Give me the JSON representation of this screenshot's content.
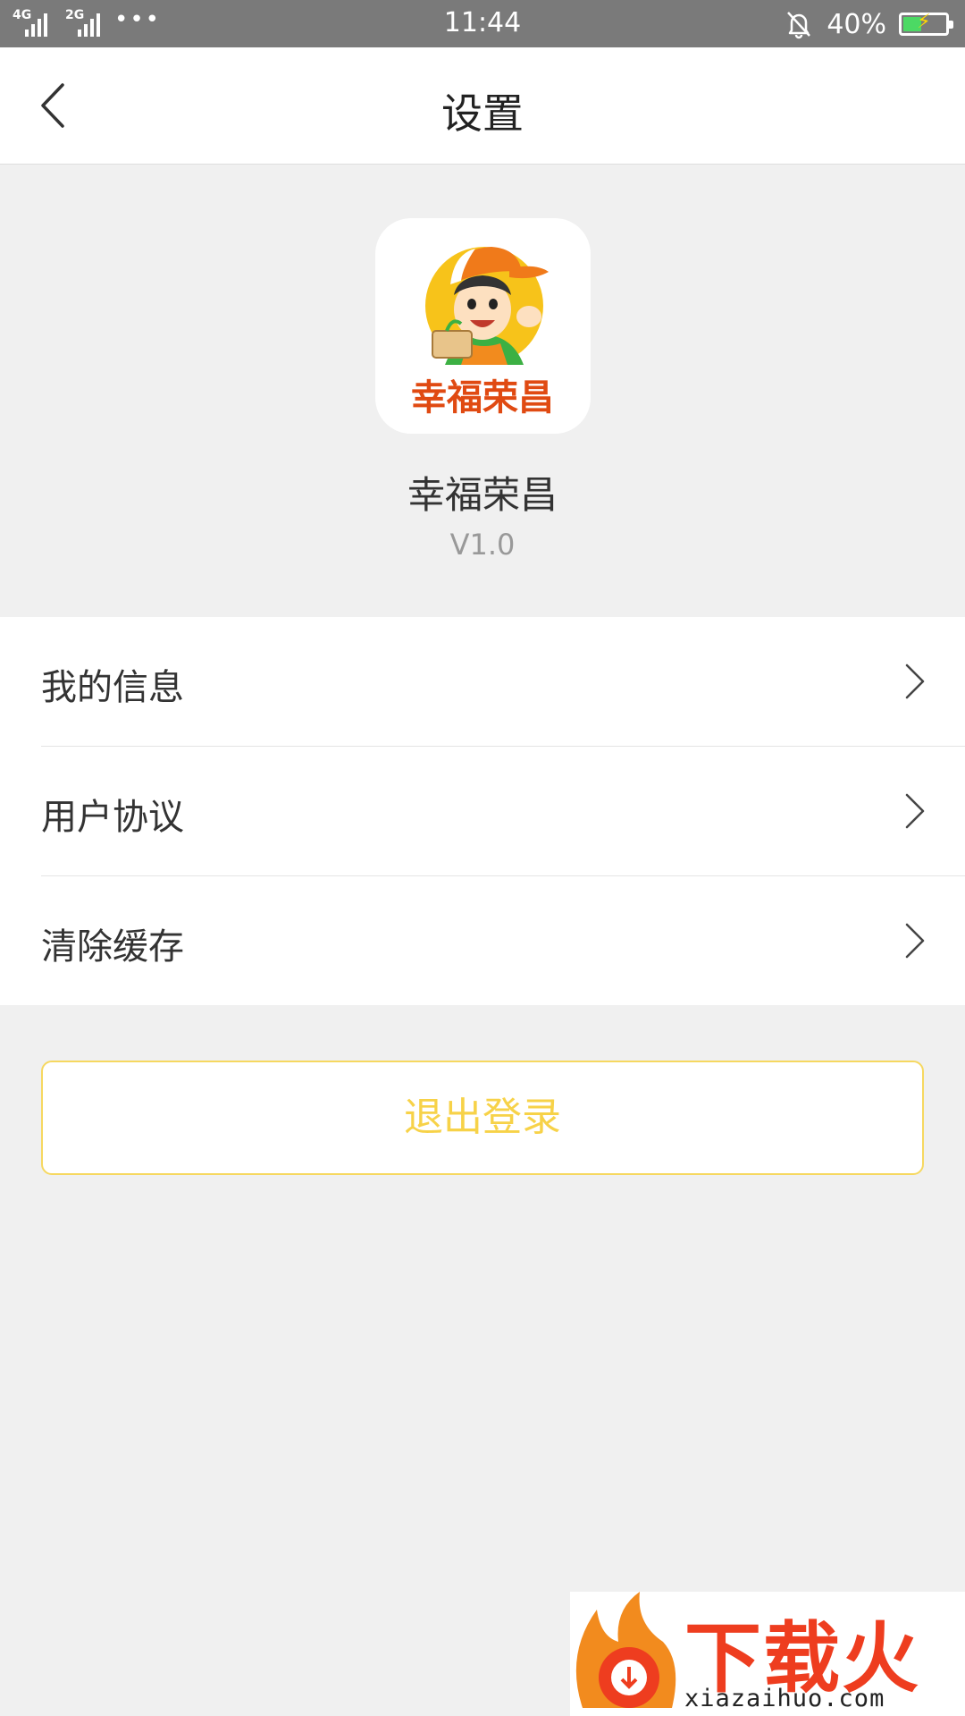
{
  "status_bar": {
    "sig1_label": "4G",
    "sig1_sub": "4G",
    "sig2_label": "2G",
    "more": "•••",
    "time": "11:44",
    "battery_pct": "40%",
    "battery_level": 0.4,
    "battery_color": "#4cd964",
    "icons": [
      "signal-icon",
      "signal-icon",
      "more-dots-icon",
      "bell-muted-icon",
      "battery-charging-icon"
    ]
  },
  "nav": {
    "title": "设置",
    "back_icon": "chevron-left-icon"
  },
  "app": {
    "logo_text": "幸福荣昌",
    "name": "幸福荣昌",
    "version": "V1.0"
  },
  "menu": {
    "items": [
      {
        "label": "我的信息",
        "icon": "chevron-right-icon"
      },
      {
        "label": "用户协议",
        "icon": "chevron-right-icon"
      },
      {
        "label": "清除缓存",
        "icon": "chevron-right-icon"
      }
    ]
  },
  "logout": {
    "label": "退出登录",
    "color": "#f7d248"
  },
  "watermark": {
    "title": "下载火",
    "url": "xiazaihuo.com"
  },
  "colors": {
    "background": "#f0f0f0",
    "status_bar": "#7a7a7a",
    "accent": "#f7d248"
  }
}
